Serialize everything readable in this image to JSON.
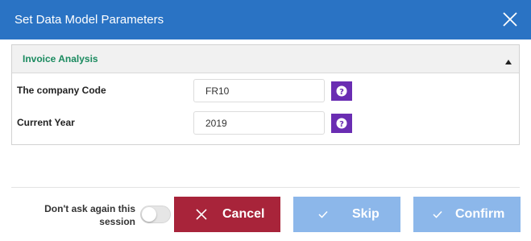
{
  "dialog": {
    "title": "Set Data Model Parameters",
    "close_icon": "close-icon"
  },
  "panel": {
    "title": "Invoice Analysis",
    "collapse_icon": "caret-up-icon",
    "params": [
      {
        "label": "The company Code",
        "value": "FR10",
        "help_icon": "question-circle-icon"
      },
      {
        "label": "Current Year",
        "value": "2019",
        "help_icon": "question-circle-icon"
      }
    ]
  },
  "footer": {
    "dont_ask_label": "Don't ask again this session",
    "dont_ask_enabled": false,
    "cancel_label": "Cancel",
    "skip_label": "Skip",
    "confirm_label": "Confirm"
  },
  "colors": {
    "titlebar": "#2a73c4",
    "panel_title": "#1a8a5f",
    "help_button": "#6a2db2",
    "cancel_button": "#a8243a",
    "disabled_button": "#8cb7ea"
  }
}
